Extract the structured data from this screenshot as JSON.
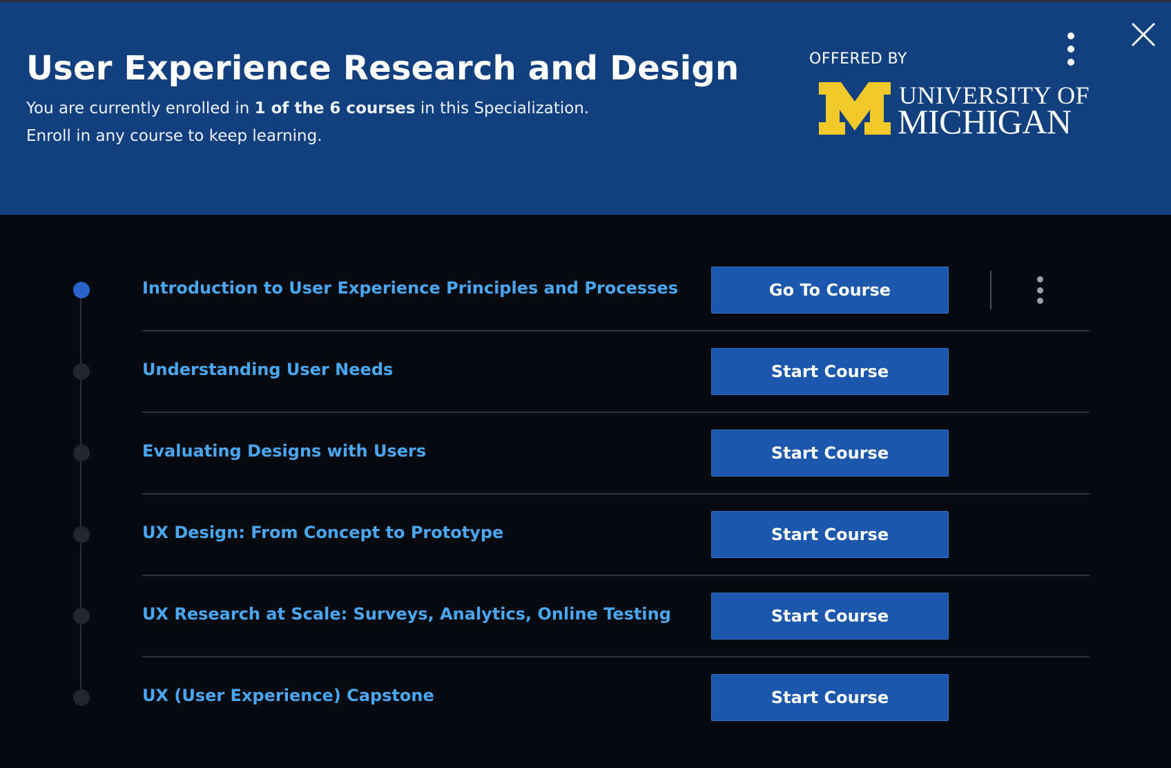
{
  "header": {
    "title": "User Experience Research and Design",
    "enrollment_prefix": "You are currently enrolled in ",
    "enrollment_bold": "1 of the 6 courses",
    "enrollment_suffix": " in this Specialization.",
    "enrollment_line2": "Enroll in any course to keep learning.",
    "offered_by_label": "OFFERED BY",
    "university_line1": "UNIVERSITY OF",
    "university_line2": "MICHIGAN",
    "menu_icon": "more-vertical-icon",
    "close_icon": "close-icon"
  },
  "colors": {
    "header_bg": "#12407f",
    "body_bg": "#070b0f",
    "link": "#4aa6f0",
    "button": "#1b57ac",
    "michigan_maize": "#f2c92a",
    "active_dot": "#2a63c9"
  },
  "courses": [
    {
      "title": "Introduction to User Experience Principles and Processes",
      "button": "Go To Course",
      "enrolled": true
    },
    {
      "title": "Understanding User Needs",
      "button": "Start Course",
      "enrolled": false
    },
    {
      "title": "Evaluating Designs with Users",
      "button": "Start Course",
      "enrolled": false
    },
    {
      "title": "UX Design: From Concept to Prototype",
      "button": "Start Course",
      "enrolled": false
    },
    {
      "title": "UX Research at Scale: Surveys, Analytics, Online Testing",
      "button": "Start Course",
      "enrolled": false
    },
    {
      "title": "UX (User Experience) Capstone",
      "button": "Start Course",
      "enrolled": false
    }
  ]
}
